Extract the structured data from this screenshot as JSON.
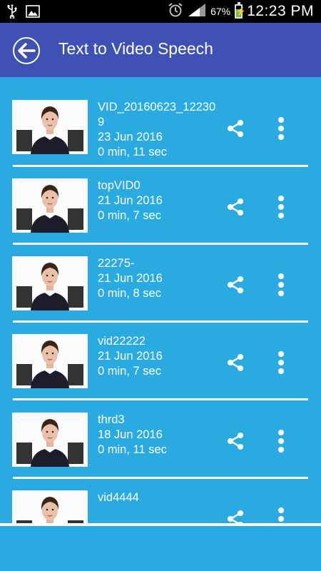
{
  "status_bar": {
    "battery_percent": "67%",
    "time": "12:23 PM",
    "icons": [
      "usb-icon",
      "image-icon",
      "alarm-icon",
      "signal-icon",
      "battery-charging-icon"
    ]
  },
  "app_bar": {
    "title": "Text to Video Speech",
    "back_icon": "back-arrow-icon"
  },
  "videos": [
    {
      "name": "VID_20160623_122309",
      "date": "23 Jun 2016",
      "duration": "0 min, 11 sec"
    },
    {
      "name": "topVID0",
      "date": "21 Jun 2016",
      "duration": "0 min, 7 sec"
    },
    {
      "name": "22275-",
      "date": "21 Jun 2016",
      "duration": "0 min, 8 sec"
    },
    {
      "name": "vid22222",
      "date": "21 Jun 2016",
      "duration": "0 min, 7 sec"
    },
    {
      "name": "thrd3",
      "date": "18 Jun 2016",
      "duration": "0 min, 11 sec"
    },
    {
      "name": "vid4444",
      "date": "",
      "duration": ""
    }
  ],
  "colors": {
    "background": "#29abe2",
    "app_bar": "#3f51b5",
    "status_bar": "#000000",
    "text": "#ffffff"
  }
}
